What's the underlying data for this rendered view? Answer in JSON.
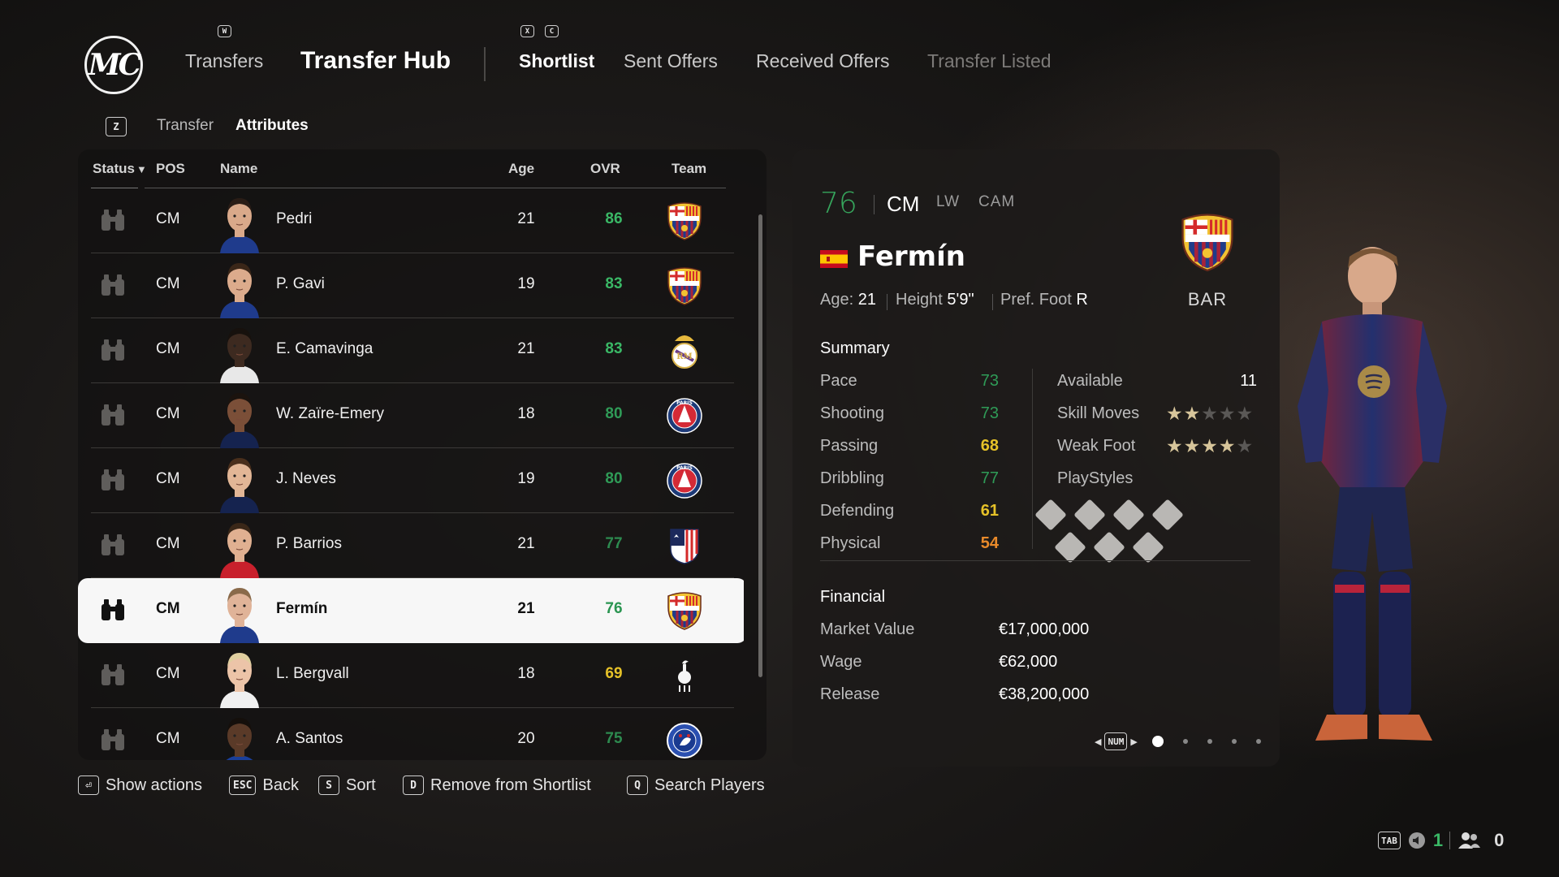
{
  "logo": {
    "text": "MC"
  },
  "nav": {
    "key_left": "W",
    "transfers": "Transfers",
    "hub_title": "Transfer Hub",
    "key_x": "X",
    "key_c": "C",
    "tabs": [
      {
        "label": "Shortlist",
        "state": "active"
      },
      {
        "label": "Sent Offers",
        "state": "normal"
      },
      {
        "label": "Received Offers",
        "state": "normal"
      },
      {
        "label": "Transfer Listed",
        "state": "disabled"
      }
    ]
  },
  "subtabs": {
    "key": "Z",
    "items": [
      "Transfer",
      "Attributes"
    ],
    "active": "Attributes"
  },
  "list": {
    "columns": {
      "status": "Status",
      "sort_arrow": "▼",
      "pos": "POS",
      "name": "Name",
      "age": "Age",
      "ovr": "OVR",
      "team": "Team"
    },
    "rows": [
      {
        "pos": "CM",
        "name": "Pedri",
        "age": "21",
        "ovr": "86",
        "ovr_color": "#3ab866",
        "club": "barcelona",
        "skin": "#d9a98a",
        "hair": "#2a1d16",
        "shirt": "#1f3b8c",
        "selected": false
      },
      {
        "pos": "CM",
        "name": "P. Gavi",
        "age": "19",
        "ovr": "83",
        "ovr_color": "#3ab866",
        "club": "barcelona",
        "skin": "#dcab8c",
        "hair": "#3a2618",
        "shirt": "#1f3b8c",
        "selected": false
      },
      {
        "pos": "CM",
        "name": "E. Camavinga",
        "age": "21",
        "ovr": "83",
        "ovr_color": "#3ab866",
        "club": "realmadrid",
        "skin": "#3d2a20",
        "hair": "#17110d",
        "shirt": "#e8e8e8",
        "selected": false
      },
      {
        "pos": "CM",
        "name": "W. Zaïre-Emery",
        "age": "18",
        "ovr": "80",
        "ovr_color": "#2f9b57",
        "club": "psg",
        "skin": "#7b4f38",
        "hair": "#1b130e",
        "shirt": "#15234f",
        "selected": false
      },
      {
        "pos": "CM",
        "name": "J. Neves",
        "age": "19",
        "ovr": "80",
        "ovr_color": "#2f9b57",
        "club": "psg",
        "skin": "#e2b696",
        "hair": "#4a2f1c",
        "shirt": "#15234f",
        "selected": false
      },
      {
        "pos": "CM",
        "name": "P. Barrios",
        "age": "21",
        "ovr": "77",
        "ovr_color": "#2d8a4f",
        "club": "atletico",
        "skin": "#e0b091",
        "hair": "#3a2718",
        "shirt": "#c8202c",
        "selected": false
      },
      {
        "pos": "CM",
        "name": "Fermín",
        "age": "21",
        "ovr": "76",
        "ovr_color": "#2a9551",
        "club": "barcelona",
        "skin": "#e0b398",
        "hair": "#8a6a4a",
        "shirt": "#1f3b8c",
        "selected": true
      },
      {
        "pos": "CM",
        "name": "L. Bergvall",
        "age": "18",
        "ovr": "69",
        "ovr_color": "#e6c228",
        "club": "tottenham",
        "skin": "#ecc4a8",
        "hair": "#e0cf9f",
        "shirt": "#f0f0f0",
        "selected": false
      },
      {
        "pos": "CM",
        "name": "A. Santos",
        "age": "20",
        "ovr": "75",
        "ovr_color": "#2d8a4f",
        "club": "chelsea",
        "skin": "#5a3a28",
        "hair": "#150f0b",
        "shirt": "#1a3f9a",
        "selected": false
      }
    ]
  },
  "footer_hints": [
    {
      "key": "⏎",
      "label": "Show actions"
    },
    {
      "key": "ESC",
      "label": "Back"
    },
    {
      "key": "S",
      "label": "Sort"
    },
    {
      "key": "D",
      "label": "Remove from Shortlist"
    },
    {
      "key": "Q",
      "label": "Search Players"
    }
  ],
  "detail": {
    "ovr": "76",
    "position": "CM",
    "alt_positions": [
      "LW",
      "CAM"
    ],
    "name": "Fermín",
    "nationality_flag": "spain-flag",
    "age_label": "Age:",
    "age": "21",
    "height_label": "Height",
    "height": "5'9\"",
    "foot_label": "Pref. Foot",
    "foot": "R",
    "club_abbr": "BAR",
    "summary_title": "Summary",
    "stats": [
      {
        "label": "Pace",
        "value": "73",
        "color": "#2f9b57",
        "bold": false
      },
      {
        "label": "Shooting",
        "value": "73",
        "color": "#2f9b57",
        "bold": false
      },
      {
        "label": "Passing",
        "value": "68",
        "color": "#e6c228",
        "bold": true
      },
      {
        "label": "Dribbling",
        "value": "77",
        "color": "#2f9b57",
        "bold": false
      },
      {
        "label": "Defending",
        "value": "61",
        "color": "#e6c228",
        "bold": true
      },
      {
        "label": "Physical",
        "value": "54",
        "color": "#e98a2a",
        "bold": true
      }
    ],
    "available_label": "Available",
    "available_value": "11",
    "skill_moves_label": "Skill Moves",
    "skill_moves": 2,
    "weak_foot_label": "Weak Foot",
    "weak_foot": 4,
    "playstyles_label": "PlayStyles",
    "playstyles_count": 7,
    "financial_title": "Financial",
    "financial": [
      {
        "label": "Market Value",
        "value": "€17,000,000"
      },
      {
        "label": "Wage",
        "value": "€62,000"
      },
      {
        "label": "Release",
        "value": "€38,200,000"
      }
    ],
    "pager_key": "NUM",
    "pager_pages": 5,
    "pager_current": 1
  },
  "hud": {
    "key": "TAB",
    "count_a": "1",
    "count_b": "0",
    "count_a_color": "#3ab866"
  }
}
